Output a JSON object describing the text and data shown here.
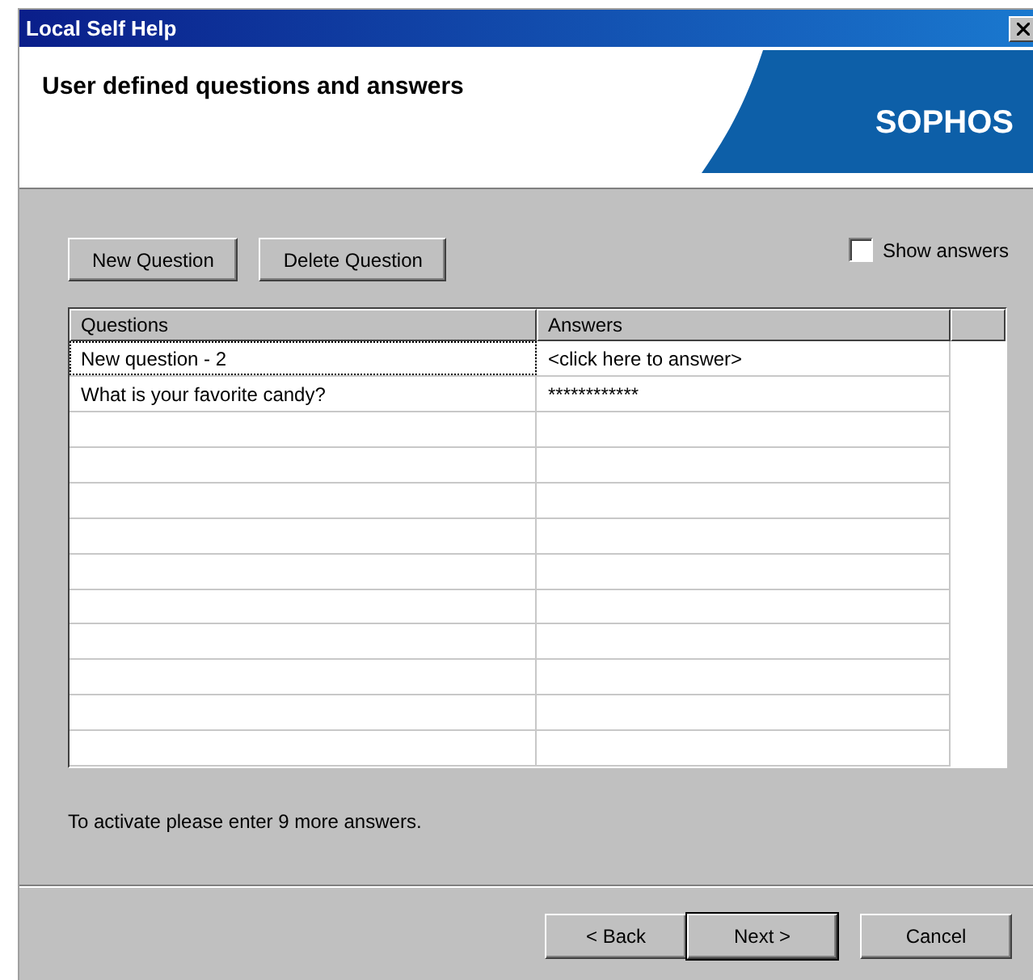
{
  "window": {
    "title": "Local Self Help"
  },
  "header": {
    "heading": "User defined questions and answers",
    "logo": "SOPHOS"
  },
  "toolbar": {
    "buttons": [
      "New Question",
      "Delete Question"
    ],
    "show_answers": {
      "label": "Show answers",
      "checked": false
    }
  },
  "table": {
    "columns": [
      "Questions",
      "Answers"
    ],
    "rows": [
      {
        "question": "New question - 2",
        "answer": "<click here to answer>",
        "focused": true
      },
      {
        "question": "What is your favorite candy?",
        "answer": "************",
        "focused": false
      }
    ]
  },
  "message": "To activate please enter 9 more answers.",
  "footer": {
    "buttons": [
      {
        "label": "< Back",
        "default": false
      },
      {
        "label": "Next >",
        "default": true
      },
      {
        "label": "Cancel",
        "default": false
      }
    ]
  }
}
